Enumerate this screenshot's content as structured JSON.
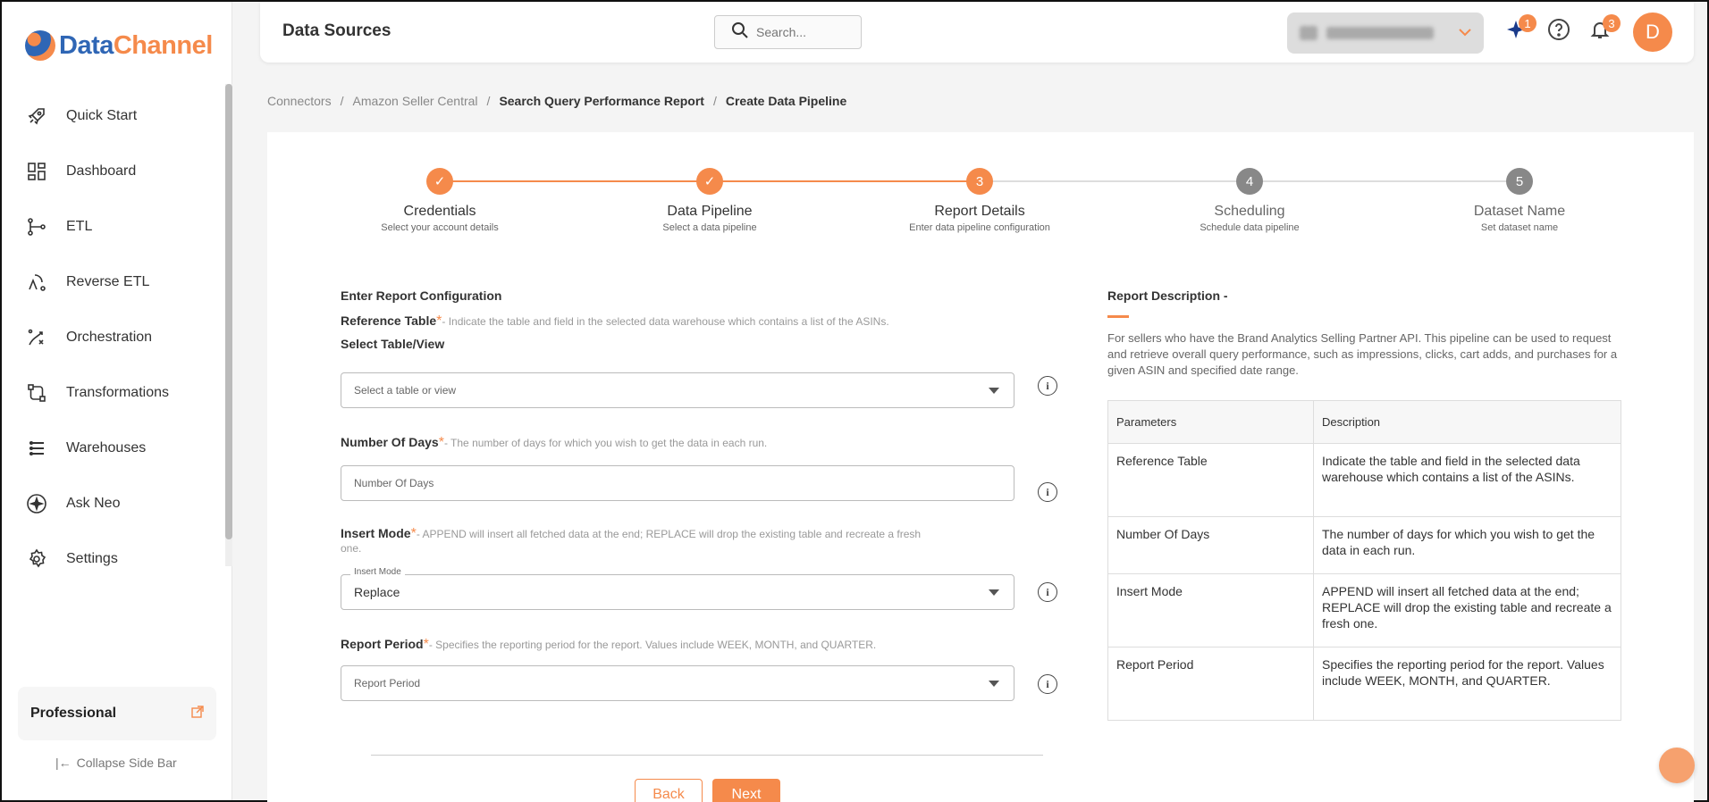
{
  "brand": {
    "name_a": "Data",
    "name_b": "Channel"
  },
  "sidebar": {
    "items": [
      {
        "label": "Quick Start",
        "icon": "rocket-icon"
      },
      {
        "label": "Dashboard",
        "icon": "dashboard-icon"
      },
      {
        "label": "ETL",
        "icon": "etl-icon"
      },
      {
        "label": "Reverse ETL",
        "icon": "reverse-etl-icon"
      },
      {
        "label": "Orchestration",
        "icon": "orchestration-icon"
      },
      {
        "label": "Transformations",
        "icon": "transformations-icon"
      },
      {
        "label": "Warehouses",
        "icon": "warehouses-icon"
      },
      {
        "label": "Ask Neo",
        "icon": "ask-neo-icon"
      },
      {
        "label": "Settings",
        "icon": "settings-icon"
      }
    ],
    "plan_label": "Professional",
    "collapse_label": "Collapse Side Bar"
  },
  "header": {
    "title": "Data Sources",
    "search_placeholder": "Search...",
    "ai_badge": "1",
    "notif_badge": "3",
    "avatar_initial": "D"
  },
  "breadcrumb": [
    "Connectors",
    "Amazon Seller Central",
    "Search Query Performance Report",
    "Create Data Pipeline"
  ],
  "stepper": {
    "steps": [
      {
        "num": "✓",
        "title": "Credentials",
        "sub": "Select your account details",
        "state": "done"
      },
      {
        "num": "✓",
        "title": "Data Pipeline",
        "sub": "Select a data pipeline",
        "state": "done"
      },
      {
        "num": "3",
        "title": "Report Details",
        "sub": "Enter data pipeline configuration",
        "state": "active"
      },
      {
        "num": "4",
        "title": "Scheduling",
        "sub": "Schedule data pipeline",
        "state": "pending"
      },
      {
        "num": "5",
        "title": "Dataset Name",
        "sub": "Set dataset name",
        "state": "pending"
      }
    ],
    "colors": {
      "done": "#f58a4b",
      "active": "#f58a4b",
      "pending": "#888888",
      "line_done": "#f58a4b",
      "line_pending": "#dddddd"
    }
  },
  "form": {
    "section_title": "Enter Report Configuration",
    "reference_table": {
      "label": "Reference Table",
      "hint": "- Indicate the table and field in the selected data warehouse which contains a list of the ASINs.",
      "sub_label": "Select Table/View",
      "placeholder": "Select a table or view"
    },
    "number_of_days": {
      "label": "Number Of Days",
      "hint": "- The number of days for which you wish to get the data in each run.",
      "placeholder": "Number Of Days"
    },
    "insert_mode": {
      "label": "Insert Mode",
      "hint": "- APPEND will insert all fetched data at the end; REPLACE will drop the existing table and recreate a fresh",
      "hint2": "one.",
      "floating": "Insert Mode",
      "value": "Replace"
    },
    "report_period": {
      "label": "Report Period",
      "hint": "- Specifies the reporting period for the report. Values include WEEK, MONTH, and QUARTER.",
      "placeholder": "Report Period"
    },
    "back_label": "Back",
    "next_label": "Next"
  },
  "description": {
    "title": "Report Description -",
    "text": "For sellers who have the Brand Analytics Selling Partner API. This pipeline can be used to request and retrieve overall query performance, such as impressions, clicks, cart adds, and purchases for a given ASIN and specified date range.",
    "headers": [
      "Parameters",
      "Description"
    ],
    "rows": [
      [
        "Reference Table",
        "Indicate the table and field in the selected data warehouse which contains a list of the ASINs."
      ],
      [
        "Number Of Days",
        "The number of days for which you wish to get the data in each run."
      ],
      [
        "Insert Mode",
        "APPEND will insert all fetched data at the end; REPLACE will drop the existing table and recreate a fresh one."
      ],
      [
        "Report Period",
        "Specifies the reporting period for the report. Values include WEEK, MONTH, and QUARTER."
      ]
    ]
  },
  "accent": "#f58a4b"
}
